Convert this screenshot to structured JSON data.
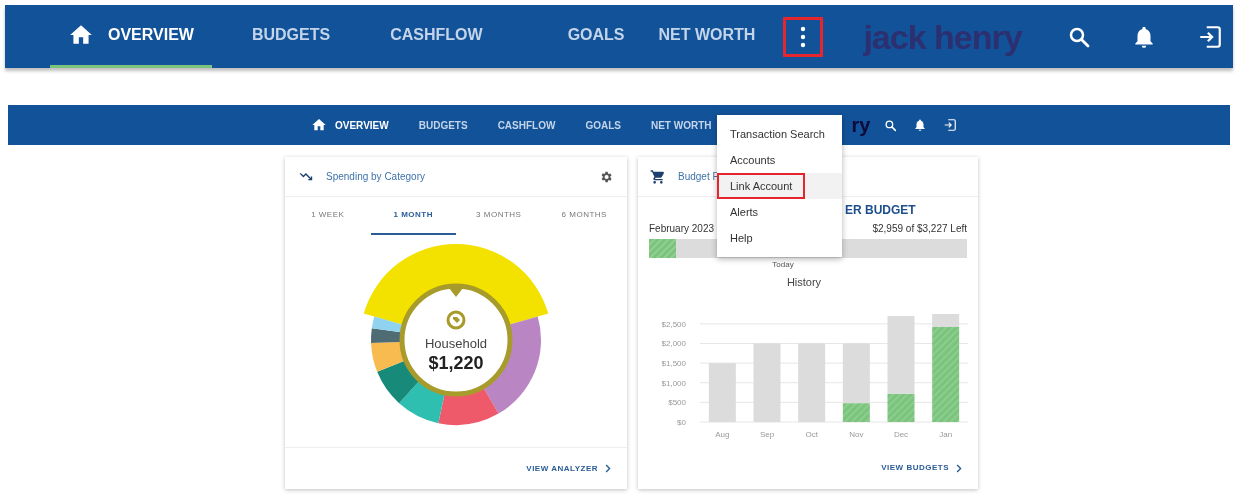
{
  "top_nav": {
    "tabs": [
      {
        "kind": "home",
        "label": "OVERVIEW",
        "selected": true
      },
      {
        "kind": "tab",
        "label": "BUDGETS",
        "selected": false
      },
      {
        "kind": "tab",
        "label": "CASHFLOW",
        "selected": false
      },
      {
        "kind": "tab",
        "label": "GOALS",
        "selected": false
      },
      {
        "kind": "tab",
        "label": "NET WORTH",
        "selected": false
      }
    ],
    "more_button": {
      "highlighted": true
    },
    "logo": "jack henry"
  },
  "app": {
    "nav": {
      "tabs": [
        {
          "kind": "home",
          "label": "OVERVIEW",
          "selected": true
        },
        {
          "kind": "tab",
          "label": "BUDGETS",
          "selected": false
        },
        {
          "kind": "tab",
          "label": "CASHFLOW",
          "selected": false
        },
        {
          "kind": "tab",
          "label": "GOALS",
          "selected": false
        },
        {
          "kind": "tab",
          "label": "NET WORTH",
          "selected": false
        }
      ],
      "logo": "ry"
    },
    "menu": {
      "items": [
        {
          "label": "Transaction Search",
          "hovered": false,
          "highlighted": false
        },
        {
          "label": "Accounts",
          "hovered": false,
          "highlighted": false
        },
        {
          "label": "Link Account",
          "hovered": true,
          "highlighted": true
        },
        {
          "label": "Alerts",
          "hovered": false,
          "highlighted": false
        },
        {
          "label": "Help",
          "hovered": false,
          "highlighted": false
        }
      ]
    },
    "spending_card": {
      "title": "Spending by Category",
      "tabs": [
        {
          "label": "1 WEEK",
          "selected": false
        },
        {
          "label": "1 MONTH",
          "selected": true
        },
        {
          "label": "3 MONTHS",
          "selected": false
        },
        {
          "label": "6 MONTHS",
          "selected": false
        }
      ],
      "center_label": "Household",
      "center_amount": "$1,220",
      "link": "VIEW ANALYZER"
    },
    "budget_card": {
      "title": "Budget F",
      "heading": "ER BUDGET",
      "period": "February 2023",
      "remaining": "$2,959 of $3,227 Left",
      "level": 0.085,
      "marker_label": "Today",
      "chart_data": {
        "type": "bar",
        "title": "History",
        "categories": [
          "Aug",
          "Sep",
          "Oct",
          "Nov",
          "Dec",
          "Jan"
        ],
        "series": [
          {
            "color": "#7cc47e",
            "values": [
              0,
              0,
              0,
              480,
              720,
              2420
            ]
          },
          {
            "color": "#dcdcdc",
            "values": [
              1500,
              2000,
              2000,
              1520,
              1980,
              330
            ]
          }
        ],
        "ylim": [
          0,
          2750
        ],
        "grid": true,
        "yticks": [
          {
            "value": 0,
            "label": "$0"
          },
          {
            "value": 500,
            "label": "$500"
          },
          {
            "value": 1000,
            "label": "$1,000"
          },
          {
            "value": 1500,
            "label": "$1,500"
          },
          {
            "value": 2000,
            "label": "$2,000"
          },
          {
            "value": 2500,
            "label": "$2,500"
          }
        ],
        "stacked": true
      },
      "link": "VIEW BUDGETS"
    }
  }
}
